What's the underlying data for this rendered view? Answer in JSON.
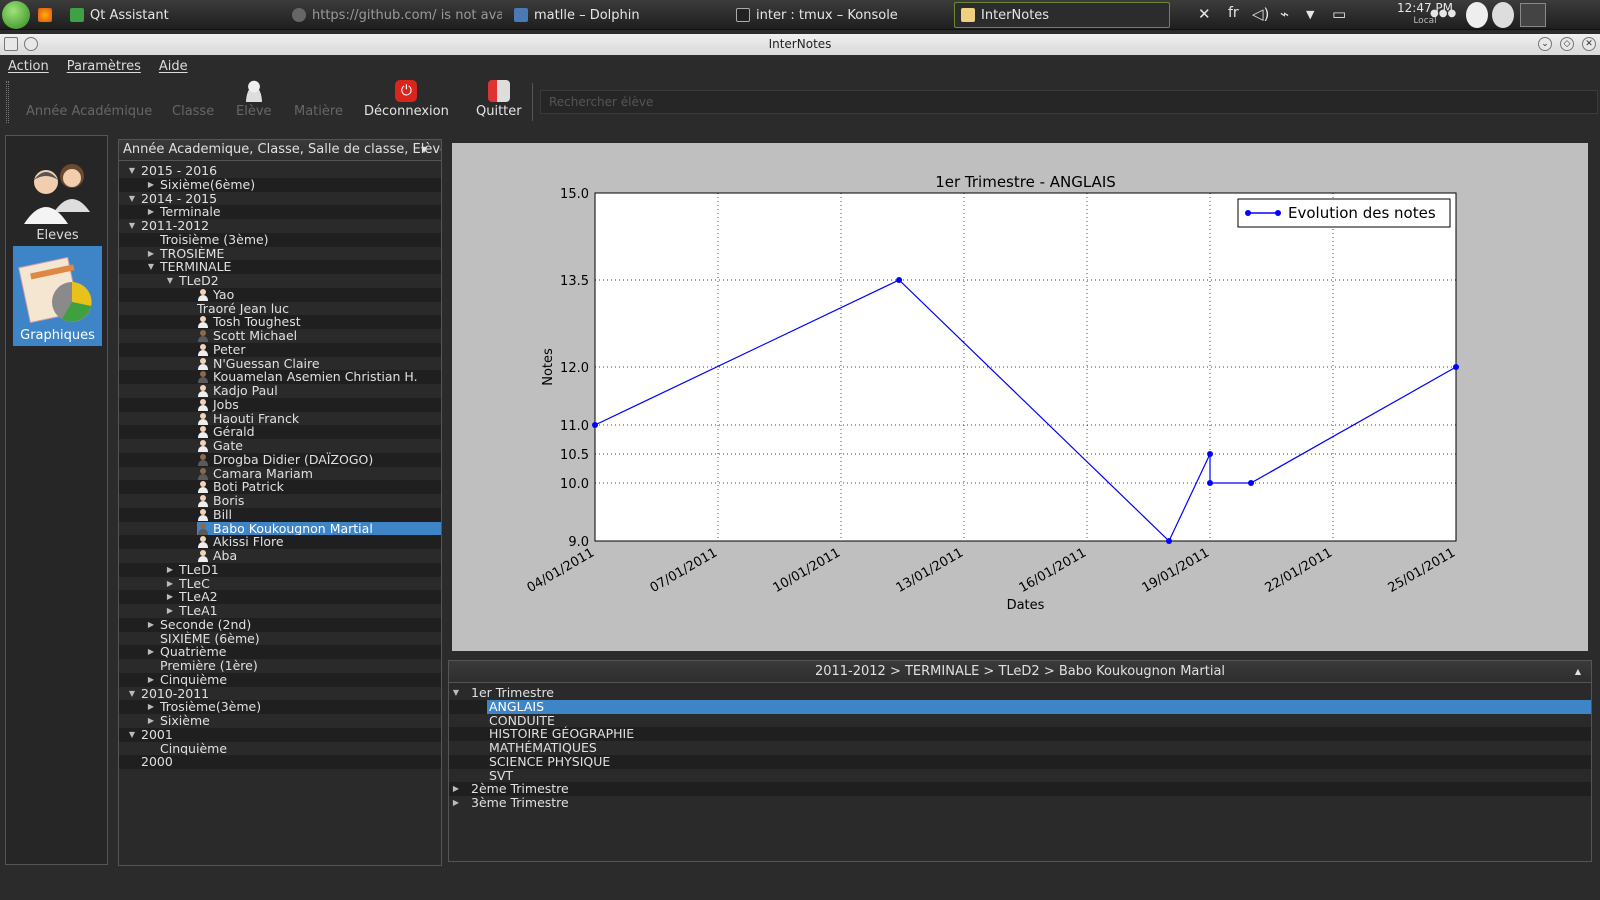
{
  "taskbar": {
    "tasks": [
      "Qt Assistant",
      "https://github.com/ is not avai",
      "matlle – Dolphin",
      "inter : tmux – Konsole",
      "InterNotes"
    ],
    "keyboard_layout": "fr",
    "clock_time": "12:47 PM",
    "clock_zone": "Local"
  },
  "window": {
    "title": "InterNotes"
  },
  "menu": [
    "Action",
    "Paramètres",
    "Aide"
  ],
  "toolbar": {
    "annee": "Année Académique",
    "classe": "Classe",
    "eleve": "Elève",
    "matiere": "Matière",
    "deconnexion": "Déconnexion",
    "quitter": "Quitter",
    "search_placeholder": "Rechercher élève"
  },
  "sidebar": {
    "eleves": "Eleves",
    "graphiques": "Graphiques"
  },
  "tree": {
    "header": "Année Academique, Classe, Salle de classe, Elève",
    "rows": [
      {
        "label": "2015 - 2016",
        "level": 0,
        "arrow": "down"
      },
      {
        "label": "Sixième(6ème)",
        "level": 1,
        "arrow": "right"
      },
      {
        "label": "2014 - 2015",
        "level": 0,
        "arrow": "down"
      },
      {
        "label": "Terminale",
        "level": 1,
        "arrow": "right"
      },
      {
        "label": "2011-2012",
        "level": 0,
        "arrow": "down"
      },
      {
        "label": "Troisième  (3ème)",
        "level": 1,
        "arrow": ""
      },
      {
        "label": "TROSIÈME",
        "level": 1,
        "arrow": "right"
      },
      {
        "label": "TERMINALE",
        "level": 1,
        "arrow": "down"
      },
      {
        "label": "TLeD2",
        "level": 2,
        "arrow": "down"
      },
      {
        "label": "Yao",
        "level": 3,
        "avatar": "default"
      },
      {
        "label": "Traoré Jean luc",
        "level": 3,
        "avatar": ""
      },
      {
        "label": "Tosh Toughest",
        "level": 3,
        "avatar": "default"
      },
      {
        "label": "Scott Michael",
        "level": 3,
        "avatar": "photo"
      },
      {
        "label": "Peter",
        "level": 3,
        "avatar": "default"
      },
      {
        "label": "N'Guessan Claire",
        "level": 3,
        "avatar": "default"
      },
      {
        "label": "Kouamelan Asemien Christian H.",
        "level": 3,
        "avatar": "photo"
      },
      {
        "label": "Kadjo Paul",
        "level": 3,
        "avatar": "default"
      },
      {
        "label": "Jobs",
        "level": 3,
        "avatar": "default"
      },
      {
        "label": "Haouti Franck",
        "level": 3,
        "avatar": "default"
      },
      {
        "label": "Gérald",
        "level": 3,
        "avatar": "default"
      },
      {
        "label": "Gate",
        "level": 3,
        "avatar": "default"
      },
      {
        "label": "Drogba Didier (DAÏZOGO)",
        "level": 3,
        "avatar": "photo"
      },
      {
        "label": "Camara Mariam",
        "level": 3,
        "avatar": "photo"
      },
      {
        "label": "Boti Patrick",
        "level": 3,
        "avatar": "default"
      },
      {
        "label": "Boris",
        "level": 3,
        "avatar": "default"
      },
      {
        "label": "Bill",
        "level": 3,
        "avatar": "default"
      },
      {
        "label": "Babo Koukougnon Martial",
        "level": 3,
        "avatar": "photo",
        "selected": true
      },
      {
        "label": "Akissi Flore",
        "level": 3,
        "avatar": "default"
      },
      {
        "label": "Aba",
        "level": 3,
        "avatar": "default"
      },
      {
        "label": "TLeD1",
        "level": 2,
        "arrow": "right"
      },
      {
        "label": "TLeC",
        "level": 2,
        "arrow": "right"
      },
      {
        "label": "TLeA2",
        "level": 2,
        "arrow": "right"
      },
      {
        "label": "TLeA1",
        "level": 2,
        "arrow": "right"
      },
      {
        "label": "Seconde (2nd)",
        "level": 1,
        "arrow": "right"
      },
      {
        "label": "SIXIÈME (6ème)",
        "level": 1,
        "arrow": ""
      },
      {
        "label": "Quatrième",
        "level": 1,
        "arrow": "right"
      },
      {
        "label": "Première (1ère)",
        "level": 1,
        "arrow": ""
      },
      {
        "label": "Cinquième",
        "level": 1,
        "arrow": "right"
      },
      {
        "label": "2010-2011",
        "level": 0,
        "arrow": "down"
      },
      {
        "label": "Trosième(3ème)",
        "level": 1,
        "arrow": "right"
      },
      {
        "label": "Sixième",
        "level": 1,
        "arrow": "right"
      },
      {
        "label": "2001",
        "level": 0,
        "arrow": "down"
      },
      {
        "label": "Cinquième",
        "level": 1,
        "arrow": ""
      },
      {
        "label": "2000",
        "level": 0,
        "arrow": ""
      }
    ]
  },
  "chart_data": {
    "type": "line",
    "title": "1er Trimestre - ANGLAIS",
    "xlabel": "Dates",
    "ylabel": "Notes",
    "x_ticks": [
      "04/01/2011",
      "07/01/2011",
      "10/01/2011",
      "13/01/2011",
      "16/01/2011",
      "19/01/2011",
      "22/01/2011",
      "25/01/2011"
    ],
    "y_ticks": [
      "9.0",
      "10.0",
      "10.5",
      "11.0",
      "12.0",
      "13.5",
      "15.0"
    ],
    "xlim": [
      "2011-01-04",
      "2011-01-25"
    ],
    "ylim": [
      9.0,
      15.0
    ],
    "grid": true,
    "legend_position": "top-right",
    "series": [
      {
        "name": "Evolution des notes",
        "color": "#0000ff",
        "points": [
          {
            "x": "2011-01-04",
            "y": 11.0
          },
          {
            "x": "2011-01-11 10:00",
            "y": 13.5
          },
          {
            "x": "2011-01-18 00:00",
            "y": 9.0
          },
          {
            "x": "2011-01-19 00:00",
            "y": 10.5
          },
          {
            "x": "2011-01-19 00:00",
            "y": 10.0
          },
          {
            "x": "2011-01-20 00:00",
            "y": 10.0
          },
          {
            "x": "2011-01-25 00:00",
            "y": 12.0
          }
        ]
      }
    ]
  },
  "breadcrumb": "2011-2012 > TERMINALE > TLeD2 > Babo Koukougnon Martial",
  "subjects": {
    "rows": [
      {
        "label": "1er Trimestre",
        "level": 0,
        "arrow": "down"
      },
      {
        "label": "ANGLAIS",
        "level": 1,
        "selected": true
      },
      {
        "label": "CONDUITE",
        "level": 1
      },
      {
        "label": "HISTOIRE GÉOGRAPHIE",
        "level": 1
      },
      {
        "label": "MATHÉMATIQUES",
        "level": 1
      },
      {
        "label": "SCIENCE PHYSIQUE",
        "level": 1
      },
      {
        "label": "SVT",
        "level": 1
      },
      {
        "label": "2ème Trimestre",
        "level": 0,
        "arrow": "right"
      },
      {
        "label": "3ème Trimestre",
        "level": 0,
        "arrow": "right"
      }
    ]
  },
  "colors": {
    "selection": "#3d85c6",
    "series": "#0000ff",
    "panel_bg": "#bfbfbf"
  }
}
